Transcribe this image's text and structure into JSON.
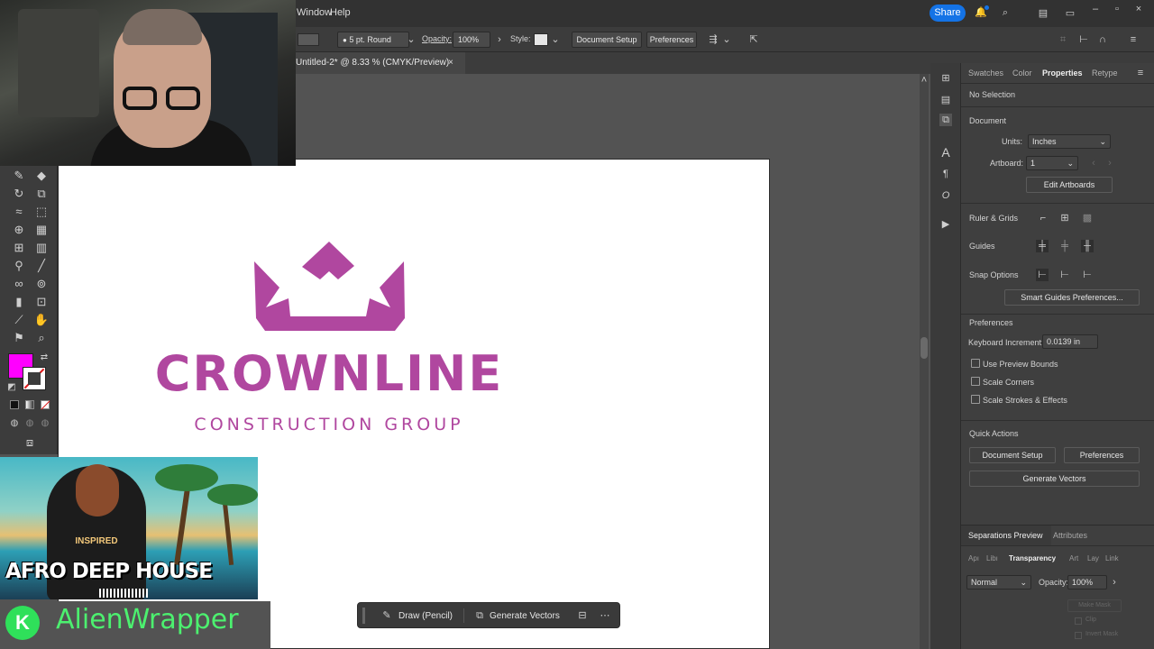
{
  "menubar": {
    "window": "Window",
    "help": "Help",
    "share": "Share"
  },
  "control_bar": {
    "brush": "5 pt. Round",
    "opacity_label": "Opacity:",
    "opacity_value": "100%",
    "style_label": "Style:",
    "document_setup": "Document Setup",
    "preferences": "Preferences"
  },
  "document_tab": {
    "title": "Untitled-2* @ 8.33 % (CMYK/Preview)"
  },
  "artboard": {
    "logo_title": "CROWNLINE",
    "logo_subtitle": "CONSTRUCTION GROUP",
    "logo_color": "#b0479f"
  },
  "overlay": {
    "music_tag": "INSPIRED",
    "music_title": "AFRO DEEP HOUSE",
    "channel_name": "AlienWrapper"
  },
  "properties": {
    "tabs": [
      "Swatches",
      "Color",
      "Properties",
      "Retype"
    ],
    "selection": "No Selection",
    "document_header": "Document",
    "units_label": "Units:",
    "units_value": "Inches",
    "artboard_label": "Artboard:",
    "artboard_value": "1",
    "edit_artboards": "Edit Artboards",
    "ruler_grids": "Ruler & Grids",
    "guides": "Guides",
    "snap_options": "Snap Options",
    "smart_guides": "Smart Guides Preferences...",
    "preferences_header": "Preferences",
    "keyboard_increment_label": "Keyboard Increment:",
    "keyboard_increment_value": "0.0139 in",
    "checkboxes": [
      "Use Preview Bounds",
      "Scale Corners",
      "Scale Strokes & Effects"
    ],
    "quick_actions": "Quick Actions",
    "qa_document_setup": "Document Setup",
    "qa_preferences": "Preferences",
    "qa_generate_vectors": "Generate Vectors"
  },
  "separations": {
    "tab_active": "Separations Preview",
    "tab_attributes": "Attributes",
    "subtabs": [
      "Apı",
      "Libı",
      "Transparency",
      "Art",
      "Lay",
      "Link"
    ],
    "blend_mode": "Normal",
    "opacity_label": "Opacity:",
    "opacity_value": "100%",
    "make_mask": "Make Mask",
    "clip": "Clip",
    "invert_mask": "Invert Mask"
  },
  "context_bar": {
    "draw": "Draw (Pencil)",
    "generate": "Generate Vectors"
  },
  "colors": {
    "fill": "#ff00ff",
    "accent": "#1473e6"
  }
}
